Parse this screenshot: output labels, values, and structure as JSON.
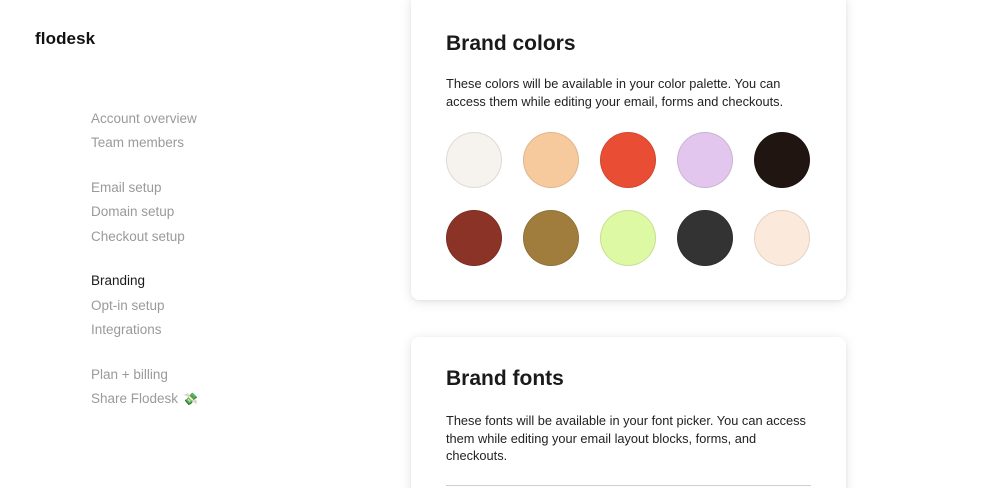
{
  "app": {
    "logo": "flodesk"
  },
  "sidebar": {
    "groups": [
      {
        "items": [
          {
            "label": "Account overview"
          },
          {
            "label": "Team members"
          }
        ]
      },
      {
        "items": [
          {
            "label": "Email setup"
          },
          {
            "label": "Domain setup"
          },
          {
            "label": "Checkout setup"
          }
        ]
      },
      {
        "items": [
          {
            "label": "Branding",
            "active": true
          },
          {
            "label": "Opt-in setup"
          },
          {
            "label": "Integrations"
          }
        ]
      },
      {
        "items": [
          {
            "label": "Plan + billing"
          },
          {
            "label": "Share Flodesk",
            "emoji": "💸"
          }
        ]
      }
    ]
  },
  "brand_colors": {
    "title": "Brand colors",
    "description": "These colors will be available in your color palette. You can access them while editing your email, forms and checkouts.",
    "swatches": [
      "#f6f2ee",
      "#f7ca9d",
      "#e94e34",
      "#e2c6ee",
      "#201510",
      "#8b3326",
      "#a07d3d",
      "#def9a4",
      "#333333",
      "#fbeadb"
    ]
  },
  "brand_fonts": {
    "title": "Brand fonts",
    "description": "These fonts will be available in your font picker. You can access them while editing your email layout blocks, forms, and checkouts."
  }
}
